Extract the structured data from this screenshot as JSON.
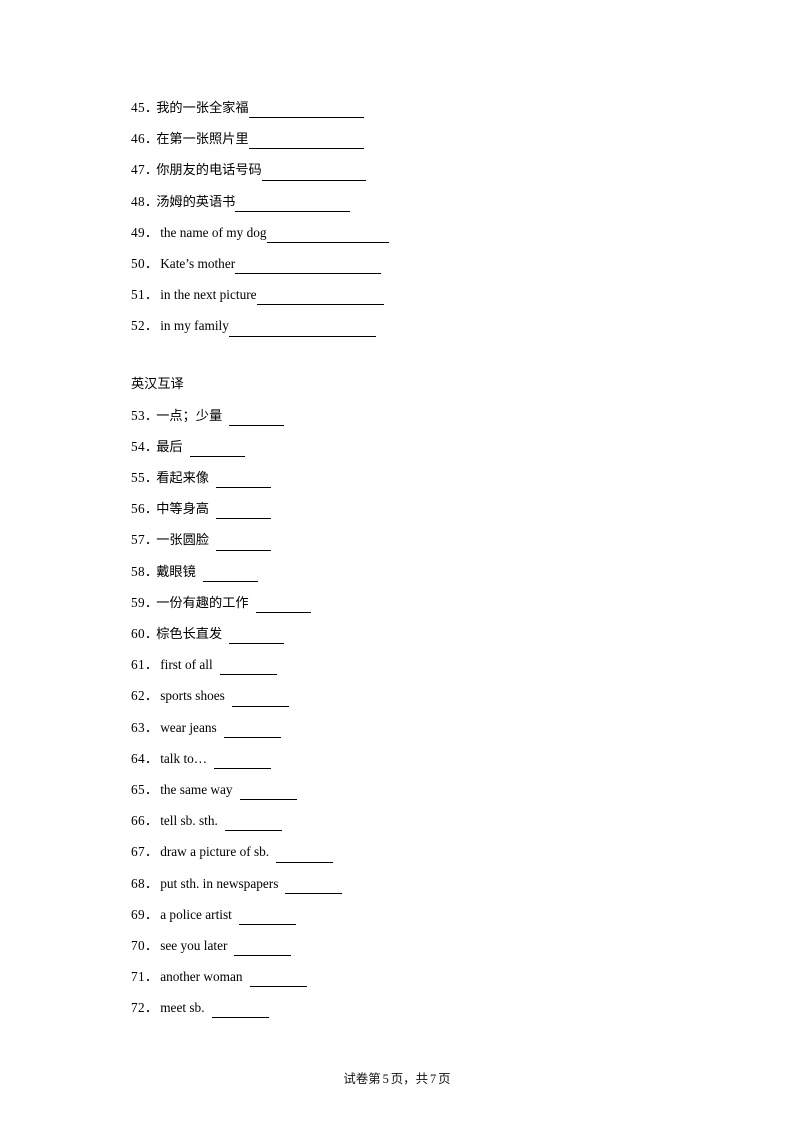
{
  "document": {
    "footer": {
      "prefix": "试卷第",
      "page": "5",
      "middle": "页，共",
      "total": "7",
      "suffix": "页"
    }
  },
  "sections": [
    {
      "heading": "",
      "items": [
        {
          "num": "45",
          "text": "我的一张全家福",
          "lang": "cn",
          "blank_width": 115,
          "gap": false
        },
        {
          "num": "46",
          "text": "在第一张照片里",
          "lang": "cn",
          "blank_width": 115,
          "gap": false
        },
        {
          "num": "47",
          "text": "你朋友的电话号码",
          "lang": "cn",
          "blank_width": 104,
          "gap": false
        },
        {
          "num": "48",
          "text": "汤姆的英语书",
          "lang": "cn",
          "blank_width": 115,
          "gap": false
        },
        {
          "num": "49",
          "text": "the name of my dog",
          "lang": "en",
          "blank_width": 122,
          "gap": false
        },
        {
          "num": "50",
          "text": "Kate’s mother",
          "lang": "en",
          "blank_width": 146,
          "gap": false
        },
        {
          "num": "51",
          "text": "in the next picture",
          "lang": "en",
          "blank_width": 127,
          "gap": false
        },
        {
          "num": "52",
          "text": "in my family",
          "lang": "en",
          "blank_width": 147,
          "gap": false
        }
      ]
    },
    {
      "heading": "英汉互译",
      "items": [
        {
          "num": "53",
          "text": "一点；少量",
          "lang": "cn",
          "blank_width": 55,
          "gap": true
        },
        {
          "num": "54",
          "text": "最后",
          "lang": "cn",
          "blank_width": 55,
          "gap": true
        },
        {
          "num": "55",
          "text": "看起来像",
          "lang": "cn",
          "blank_width": 55,
          "gap": true
        },
        {
          "num": "56",
          "text": "中等身高",
          "lang": "cn",
          "blank_width": 55,
          "gap": true
        },
        {
          "num": "57",
          "text": "一张圆脸",
          "lang": "cn",
          "blank_width": 55,
          "gap": true
        },
        {
          "num": "58",
          "text": "戴眼镜",
          "lang": "cn",
          "blank_width": 55,
          "gap": true
        },
        {
          "num": "59",
          "text": "一份有趣的工作",
          "lang": "cn",
          "blank_width": 55,
          "gap": true
        },
        {
          "num": "60",
          "text": "棕色长直发",
          "lang": "cn",
          "blank_width": 55,
          "gap": true
        },
        {
          "num": "61",
          "text": "first of all",
          "lang": "en",
          "blank_width": 57,
          "gap": true
        },
        {
          "num": "62",
          "text": "sports shoes",
          "lang": "en",
          "blank_width": 57,
          "gap": true
        },
        {
          "num": "63",
          "text": "wear jeans",
          "lang": "en",
          "blank_width": 57,
          "gap": true
        },
        {
          "num": "64",
          "text": "talk to…",
          "lang": "en",
          "blank_width": 57,
          "gap": true
        },
        {
          "num": "65",
          "text": "the same way",
          "lang": "en",
          "blank_width": 57,
          "gap": true
        },
        {
          "num": "66",
          "text": "tell sb. sth.",
          "lang": "en",
          "blank_width": 57,
          "gap": true
        },
        {
          "num": "67",
          "text": "draw a picture of sb.",
          "lang": "en",
          "blank_width": 57,
          "gap": true
        },
        {
          "num": "68",
          "text": "put sth. in newspapers",
          "lang": "en",
          "blank_width": 57,
          "gap": true
        },
        {
          "num": "69",
          "text": "a police artist",
          "lang": "en",
          "blank_width": 57,
          "gap": true
        },
        {
          "num": "70",
          "text": "see you later",
          "lang": "en",
          "blank_width": 57,
          "gap": true
        },
        {
          "num": "71",
          "text": "another woman",
          "lang": "en",
          "blank_width": 57,
          "gap": true
        },
        {
          "num": "72",
          "text": "meet sb.",
          "lang": "en",
          "blank_width": 57,
          "gap": true
        }
      ]
    }
  ]
}
